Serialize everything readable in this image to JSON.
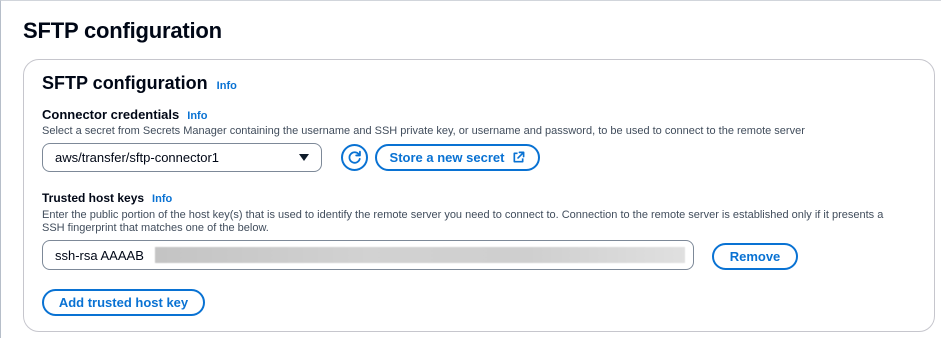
{
  "page": {
    "title": "SFTP configuration"
  },
  "section": {
    "title": "SFTP configuration",
    "info": "Info"
  },
  "credentials": {
    "label": "Connector credentials",
    "info": "Info",
    "description": "Select a secret from Secrets Manager containing the username and SSH private key, or username and password, to be used to connect to the remote server",
    "selected_value": "aws/transfer/sftp-connector1",
    "store_button": "Store a new secret"
  },
  "trusted_keys": {
    "label": "Trusted host keys",
    "info": "Info",
    "description_line1": "Enter the public portion of the host key(s) that is used to identify the remote server you need to connect to. Connection to the remote server is established only if it presents a",
    "description_line2": "SSH fingerprint that matches one of the below.",
    "key_value": "ssh-rsa AAAAB",
    "remove_button": "Remove",
    "add_button": "Add trusted host key"
  },
  "colors": {
    "accent": "#0972d3",
    "text": "#000716",
    "muted": "#414d5c",
    "border": "#7d8998"
  },
  "icons": {
    "refresh": "refresh-icon",
    "external": "external-link-icon",
    "caret": "caret-down-icon"
  }
}
